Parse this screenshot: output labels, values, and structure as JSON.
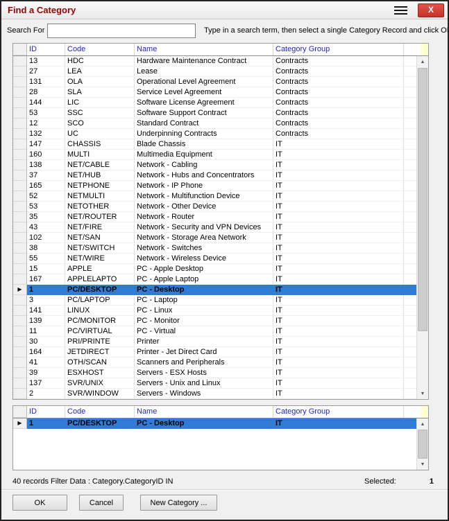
{
  "window": {
    "title": "Find a Category",
    "close_label": "X"
  },
  "search": {
    "label": "Search For",
    "value": "",
    "instruction": "Type in a search term, then select a single Category Record and click OK"
  },
  "main_grid": {
    "columns": [
      "ID",
      "Code",
      "Name",
      "Category Group"
    ],
    "selected_index": 22,
    "rows": [
      [
        "13",
        "HDC",
        "Hardware Maintenance Contract",
        "Contracts"
      ],
      [
        "27",
        "LEA",
        "Lease",
        "Contracts"
      ],
      [
        "131",
        "OLA",
        "Operational Level Agreement",
        "Contracts"
      ],
      [
        "28",
        "SLA",
        "Service Level Agreement",
        "Contracts"
      ],
      [
        "144",
        "LIC",
        "Software License Agreement",
        "Contracts"
      ],
      [
        "53",
        "SSC",
        "Software Support Contract",
        "Contracts"
      ],
      [
        "12",
        "SCO",
        "Standard Contract",
        "Contracts"
      ],
      [
        "132",
        "UC",
        "Underpinning Contracts",
        "Contracts"
      ],
      [
        "147",
        "CHASSIS",
        "Blade Chassis",
        "IT"
      ],
      [
        "160",
        "MULTI",
        "Multimedia Equipment",
        "IT"
      ],
      [
        "138",
        "NET/CABLE",
        "Network - Cabling",
        "IT"
      ],
      [
        "37",
        "NET/HUB",
        "Network - Hubs and Concentrators",
        "IT"
      ],
      [
        "165",
        "NETPHONE",
        "Network - IP Phone",
        "IT"
      ],
      [
        "52",
        "NETMULTI",
        "Network - Multifunction Device",
        "IT"
      ],
      [
        "53",
        "NETOTHER",
        "Network - Other Device",
        "IT"
      ],
      [
        "35",
        "NET/ROUTER",
        "Network - Router",
        "IT"
      ],
      [
        "43",
        "NET/FIRE",
        "Network - Security and VPN Devices",
        "IT"
      ],
      [
        "102",
        "NET/SAN",
        "Network - Storage Area Network",
        "IT"
      ],
      [
        "38",
        "NET/SWITCH",
        "Network - Switches",
        "IT"
      ],
      [
        "55",
        "NET/WIRE",
        "Network - Wireless Device",
        "IT"
      ],
      [
        "15",
        "APPLE",
        "PC - Apple Desktop",
        "IT"
      ],
      [
        "167",
        "APPLELAPTO",
        "PC - Apple Laptop",
        "IT"
      ],
      [
        "1",
        "PC/DESKTOP",
        "PC - Desktop",
        "IT"
      ],
      [
        "3",
        "PC/LAPTOP",
        "PC - Laptop",
        "IT"
      ],
      [
        "141",
        "LINUX",
        "PC - Linux",
        "IT"
      ],
      [
        "139",
        "PC/MONITOR",
        "PC - Monitor",
        "IT"
      ],
      [
        "11",
        "PC/VIRTUAL",
        "PC - Virtual",
        "IT"
      ],
      [
        "30",
        "PRI/PRINTE",
        "Printer",
        "IT"
      ],
      [
        "164",
        "JETDIRECT",
        "Printer - Jet Direct Card",
        "IT"
      ],
      [
        "41",
        "OTH/SCAN",
        "Scanners and Peripherals",
        "IT"
      ],
      [
        "39",
        "ESXHOST",
        "Servers - ESX Hosts",
        "IT"
      ],
      [
        "137",
        "SVR/UNIX",
        "Servers - Unix and Linux",
        "IT"
      ],
      [
        "2",
        "SVR/WINDOW",
        "Servers - Windows",
        "IT"
      ]
    ]
  },
  "selection_grid": {
    "columns": [
      "ID",
      "Code",
      "Name",
      "Category Group"
    ],
    "selected_index": 0,
    "rows": [
      [
        "1",
        "PC/DESKTOP",
        "PC - Desktop",
        "IT"
      ]
    ]
  },
  "status": {
    "records_text": "40 records Filter Data : Category.CategoryID IN",
    "selected_label": "Selected:",
    "selected_count": "1"
  },
  "buttons": {
    "ok": "OK",
    "cancel": "Cancel",
    "new_category": "New Category ..."
  },
  "icons": {
    "menu": "hamburger-menu-icon",
    "scroll_up": "▲",
    "scroll_down": "▼",
    "current_row": "▶"
  },
  "colors": {
    "title_text": "#990000",
    "close_button": "#e2544a",
    "header_text": "#2323c8",
    "selection": "#2e7cd6"
  }
}
